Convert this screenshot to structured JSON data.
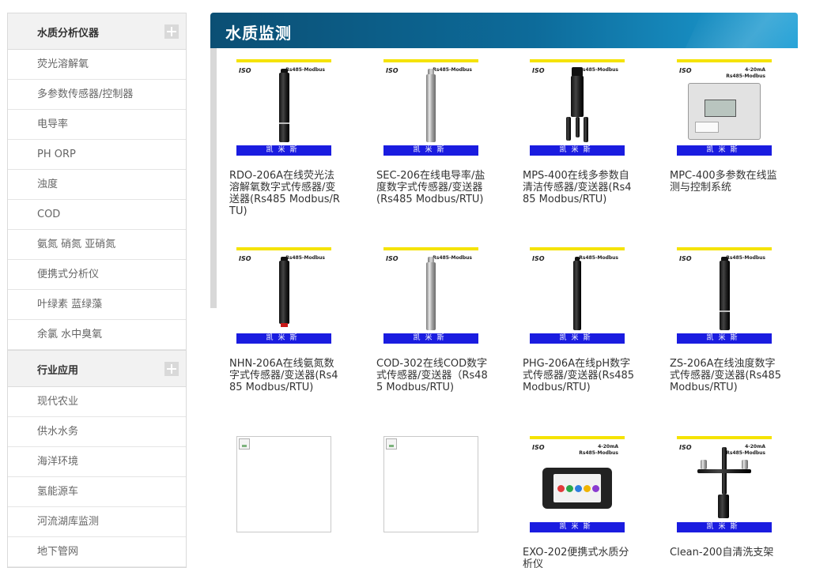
{
  "sidebar": {
    "categories": [
      {
        "title": "水质分析仪器",
        "items": [
          "荧光溶解氧",
          "多参数传感器/控制器",
          "电导率",
          "PH ORP",
          "浊度",
          "COD",
          "氨氮 硝氮 亚硝氮",
          "便携式分析仪",
          "叶绿素 蓝绿藻",
          "余氯 水中臭氧"
        ]
      },
      {
        "title": "行业应用",
        "items": [
          "现代农业",
          "供水水务",
          "海洋环境",
          "氢能源车",
          "河流湖库监测",
          "地下管网"
        ]
      }
    ]
  },
  "main": {
    "title": "水质监测",
    "products": [
      {
        "name": "RDO-206A在线荧光法溶解氧数字式传感器/变送器(Rs485 Modbus/RTU)",
        "iso": "ISO",
        "spec": "Rs485-Modbus",
        "brand": "凯米斯",
        "icon": "dark-probe"
      },
      {
        "name": "SEC-206在线电导率/盐度数字式传感器/变送器(Rs485 Modbus/RTU)",
        "iso": "ISO",
        "spec": "Rs485-Modbus",
        "brand": "凯米斯",
        "icon": "steel-probe"
      },
      {
        "name": "MPS-400在线多参数自清洁传感器/变送器(Rs485 Modbus/RTU)",
        "iso": "ISO",
        "spec": "Rs485-Modbus",
        "brand": "凯米斯",
        "icon": "multi-probe"
      },
      {
        "name": "MPC-400多参数在线监测与控制系统",
        "iso": "ISO",
        "spec": "4-20mA\nRs485-Modbus",
        "brand": "凯米斯",
        "icon": "controller"
      },
      {
        "name": "NHN-206A在线氨氮数字式传感器/变送器(Rs485 Modbus/RTU)",
        "iso": "ISO",
        "spec": "Rs485-Modbus",
        "brand": "凯米斯",
        "icon": "dark-probe-red"
      },
      {
        "name": "COD-302在线COD数字式传感器/变送器（Rs485 Modbus/RTU)",
        "iso": "ISO",
        "spec": "Rs485-Modbus",
        "brand": "凯米斯",
        "icon": "steel-probe"
      },
      {
        "name": "PHG-206A在线pH数字式传感器/变送器(Rs485 Modbus/RTU)",
        "iso": "ISO",
        "spec": "Rs485-Modbus",
        "brand": "凯米斯",
        "icon": "dark-probe-thin"
      },
      {
        "name": "ZS-206A在线浊度数字式传感器/变送器(Rs485 Modbus/RTU)",
        "iso": "ISO",
        "spec": "Rs485-Modbus",
        "brand": "凯米斯",
        "icon": "dark-probe"
      },
      {
        "name": "",
        "broken": true
      },
      {
        "name": "",
        "broken": true
      },
      {
        "name": "EXO-202便携式水质分析仪",
        "iso": "ISO",
        "spec": "4-20mA\nRs485-Modbus",
        "brand": "凯米斯",
        "icon": "handheld"
      },
      {
        "name": "Clean-200自清洗支架",
        "iso": "ISO",
        "spec": "4-20mA\nRs485-Modbus",
        "brand": "凯米斯",
        "icon": "bracket"
      }
    ]
  },
  "colors": {
    "title_bar_start": "#0b4f74",
    "title_bar_end": "#1d9fd6",
    "brand_band": "#1a1ce0",
    "top_stripe": "#f5e300"
  }
}
